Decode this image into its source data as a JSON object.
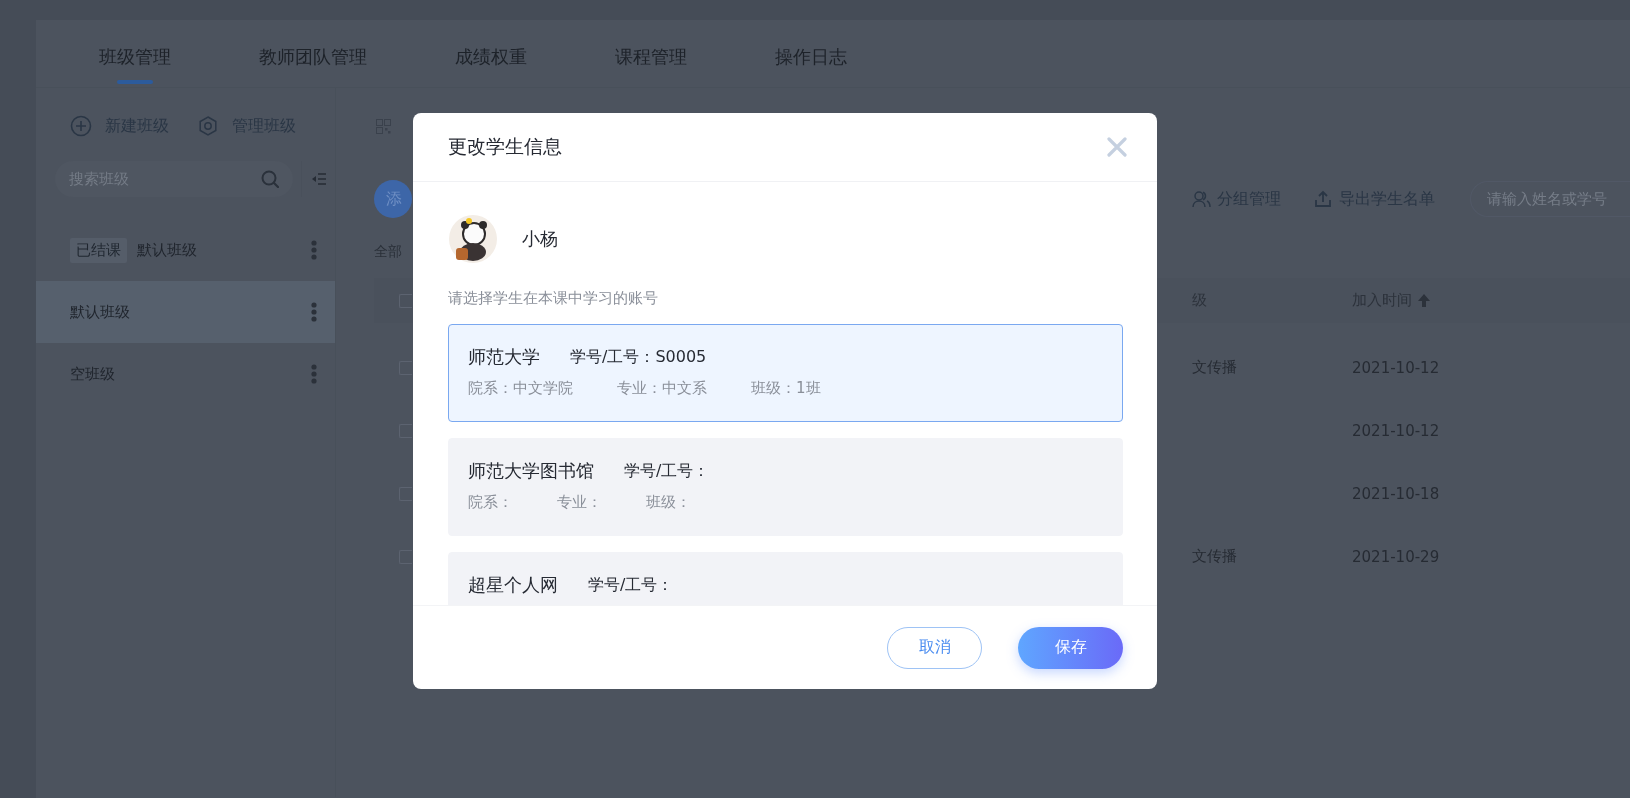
{
  "tabs": [
    {
      "label": "班级管理",
      "selected": true
    },
    {
      "label": "教师团队管理",
      "selected": false
    },
    {
      "label": "成绩权重",
      "selected": false
    },
    {
      "label": "课程管理",
      "selected": false
    },
    {
      "label": "操作日志",
      "selected": false
    }
  ],
  "class_sidebar": {
    "actions": [
      {
        "kind": "add",
        "label": "新建班级"
      },
      {
        "kind": "settings",
        "label": "管理班级"
      }
    ],
    "search": {
      "placeholder": "搜索班级"
    },
    "items": [
      {
        "tag": "已结课",
        "name": "默认班级",
        "selected": false
      },
      {
        "name": "默认班级",
        "selected": true
      },
      {
        "name": "空班级",
        "selected": false
      }
    ]
  },
  "class_panel": {
    "add_button": "添",
    "list_label": "全部",
    "toolbar": [
      {
        "kind": "group",
        "label": "分组管理"
      },
      {
        "kind": "export",
        "label": "导出学生名单"
      }
    ],
    "search": {
      "placeholder": "请输入姓名或学号"
    },
    "columns": [
      {
        "label": "级"
      },
      {
        "label": "加入时间"
      }
    ],
    "select_all": {
      "checked": false
    },
    "rows": [
      {
        "checked": false,
        "class": "文传播",
        "joined": "2021-10-12"
      },
      {
        "checked": false,
        "joined": "2021-10-12"
      },
      {
        "checked": false,
        "joined": "2021-10-18"
      },
      {
        "checked": false,
        "class": "文传播",
        "joined": "2021-10-29"
      }
    ]
  },
  "modal": {
    "title": "更改学生信息",
    "student": {
      "name": "小杨"
    },
    "hint": "请选择学生在本课中学习的账号",
    "accounts": [
      {
        "school": "师范大学",
        "id": "学号/工号：S0005",
        "details": [
          "院系：中文学院",
          "专业：中文系",
          "班级：1班"
        ],
        "selected": true
      },
      {
        "school": "师范大学图书馆",
        "id": "学号/工号：",
        "details": [
          "院系：",
          "专业：",
          "班级："
        ],
        "selected": false
      },
      {
        "school": "超星个人网",
        "id": "学号/工号：",
        "selected": false
      }
    ],
    "buttons": [
      {
        "kind": "secondary",
        "label": "取消"
      },
      {
        "kind": "primary",
        "label": "保存"
      }
    ]
  }
}
